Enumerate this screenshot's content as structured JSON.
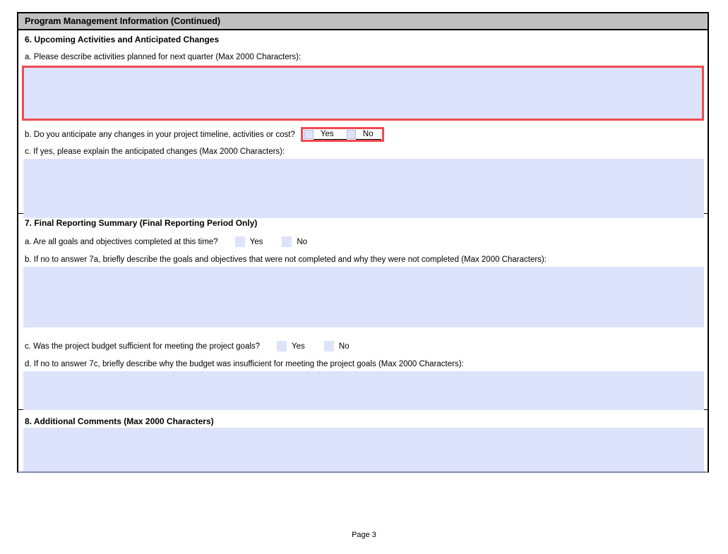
{
  "header": {
    "title": "Program Management Information (Continued)"
  },
  "s6": {
    "title": "6. Upcoming Activities and Anticipated Changes",
    "a_label": "a. Please describe activities planned for next quarter (Max 2000 Characters):",
    "a_value": "",
    "b_label": "b. Do you anticipate any changes in your project timeline, activities or cost?",
    "b_yes_label": "Yes",
    "b_no_label": "No",
    "c_label": "c. If yes, please explain the anticipated changes (Max 2000 Characters):",
    "c_value": ""
  },
  "s7": {
    "title": "7. Final Reporting Summary (Final Reporting Period Only)",
    "a_label": "a. Are all goals and objectives completed at this time?",
    "a_yes_label": "Yes",
    "a_no_label": "No",
    "b_label": "b. If no to answer 7a, briefly describe the goals and objectives that were not completed and why they were not completed (Max 2000 Characters):",
    "b_value": "",
    "c_label": "c. Was the project budget sufficient for meeting the project goals?",
    "c_yes_label": "Yes",
    "c_no_label": "No",
    "d_label": "d. If no to answer 7c, briefly describe why the budget was insufficient for meeting the project goals (Max 2000 Characters):",
    "d_value": ""
  },
  "s8": {
    "title": "8. Additional Comments (Max 2000 Characters)",
    "value": ""
  },
  "footer": {
    "page_label": "Page 3"
  },
  "colors": {
    "field_fill": "#dde3fa",
    "header_bg": "#c0c0c0",
    "highlight_red": "#ef4a4f"
  }
}
